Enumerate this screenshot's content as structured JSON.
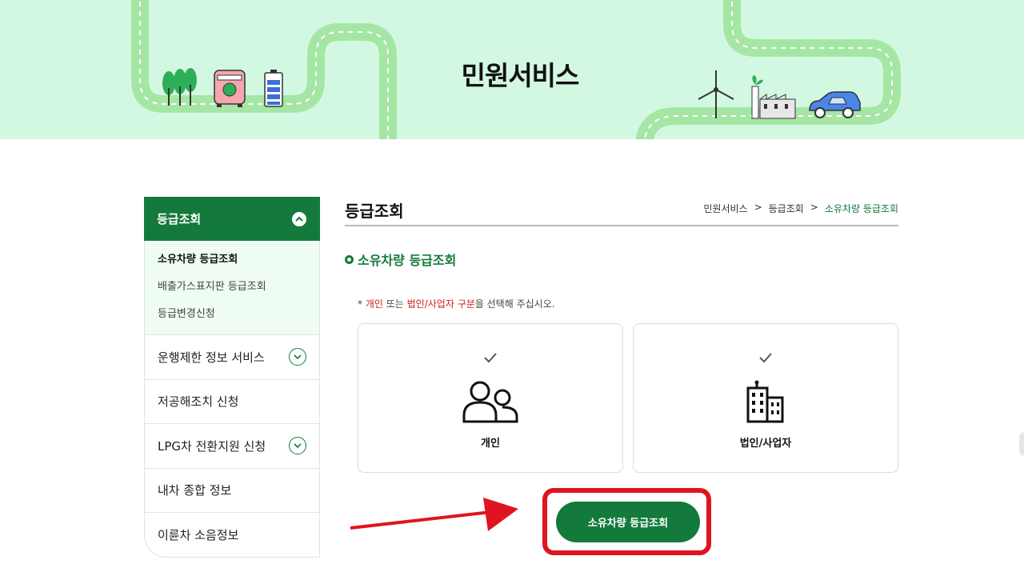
{
  "banner": {
    "title": "민원서비스"
  },
  "sidebar": {
    "header": {
      "label": "등급조회"
    },
    "sub_items": [
      {
        "label": "소유차량 등급조회"
      },
      {
        "label": "배출가스표지판 등급조회"
      },
      {
        "label": "등급변경신청"
      }
    ],
    "items": [
      {
        "label": "운행제한 정보 서비스"
      },
      {
        "label": "저공해조치 신청"
      },
      {
        "label": "LPG차 전환지원 신청"
      },
      {
        "label": "내차 종합 정보"
      },
      {
        "label": "이륜차 소음정보"
      }
    ]
  },
  "content": {
    "title": "등급조회",
    "breadcrumb": {
      "home": "민원서비스",
      "sep": ">",
      "parent": "등급조회",
      "current": "소유차량 등급조회"
    },
    "section_title": "소유차량 등급조회",
    "notice": {
      "star": "* ",
      "a": "개인",
      "b": " 또는 ",
      "c": "법인/사업자 구분",
      "d": "을 선택해 주십시오."
    },
    "options": [
      {
        "label": "개인",
        "icon": "person-group-icon"
      },
      {
        "label": "법인/사업자",
        "icon": "building-icon"
      }
    ],
    "submit_label": "소유차량 등급조회"
  },
  "colors": {
    "brand": "#137a3c",
    "banner_bg": "#d3f8e2",
    "highlight": "#e0141e"
  }
}
